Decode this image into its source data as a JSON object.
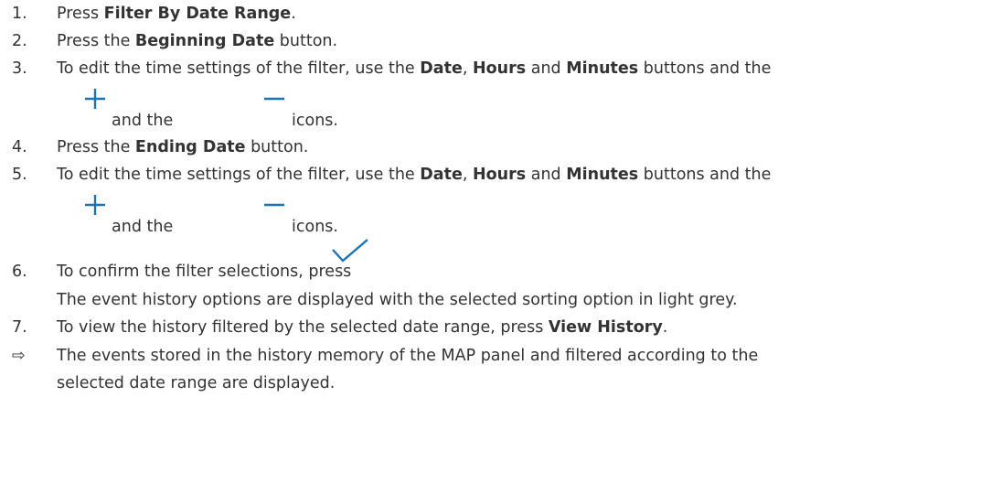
{
  "steps": [
    {
      "num": "1.",
      "pre": "Press ",
      "bold1": "Filter By Date Range",
      "post": "."
    },
    {
      "num": "2.",
      "pre": "Press the ",
      "bold1": "Beginning Date",
      "post": " button."
    },
    {
      "num": "3.",
      "pre": "To edit the time settings of the filter, use the ",
      "bold1": "Date",
      "mid1": ", ",
      "bold2": "Hours",
      "mid2": " and ",
      "bold3": "Minutes",
      "post": " buttons and the",
      "cont_and": "and the",
      "cont_icons": "icons."
    },
    {
      "num": "4.",
      "pre": "Press the ",
      "bold1": "Ending Date",
      "post": " button."
    },
    {
      "num": "5.",
      "pre": "To edit the time settings of the filter, use the ",
      "bold1": "Date",
      "mid1": ", ",
      "bold2": "Hours",
      "mid2": " and ",
      "bold3": "Minutes",
      "post": " buttons and the",
      "cont_and": "and the",
      "cont_icons": "icons."
    },
    {
      "num": "6.",
      "pre": "To confirm the filter selections, press",
      "note": "The event history options are displayed with the selected sorting option in light grey."
    },
    {
      "num": "7.",
      "pre": "To view the history filtered by the selected date range, press ",
      "bold1": "View History",
      "post": "."
    }
  ],
  "result": {
    "arrow": "⇨",
    "line1": "The events stored in the history memory of the MAP panel and filtered according to the",
    "line2": "selected date range are displayed."
  },
  "icons": {
    "plus": "plus-icon",
    "minus": "minus-icon",
    "check": "checkmark-icon",
    "accent": "#1a73b5"
  }
}
